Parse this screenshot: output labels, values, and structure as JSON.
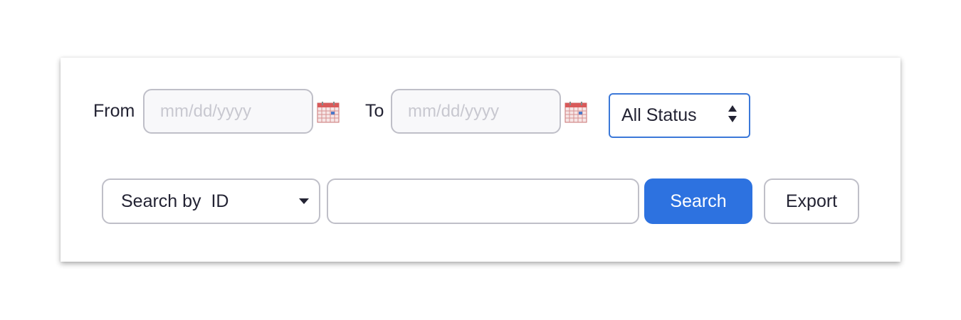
{
  "filters": {
    "from_label": "From",
    "from_placeholder": "mm/dd/yyyy",
    "to_label": "To",
    "to_placeholder": "mm/dd/yyyy",
    "status_value": "All Status"
  },
  "search": {
    "by_value": "Search by  ID",
    "input_value": "",
    "search_label": "Search",
    "export_label": "Export"
  },
  "icons": {
    "date_picker": "calendar-icon",
    "status_arrows": "up-down-arrows-icon",
    "dropdown": "caret-down-icon"
  },
  "colors": {
    "accent": "#2d72e0",
    "select_border": "#3b78d8",
    "text": "#232333",
    "border": "#bfbfc8"
  }
}
